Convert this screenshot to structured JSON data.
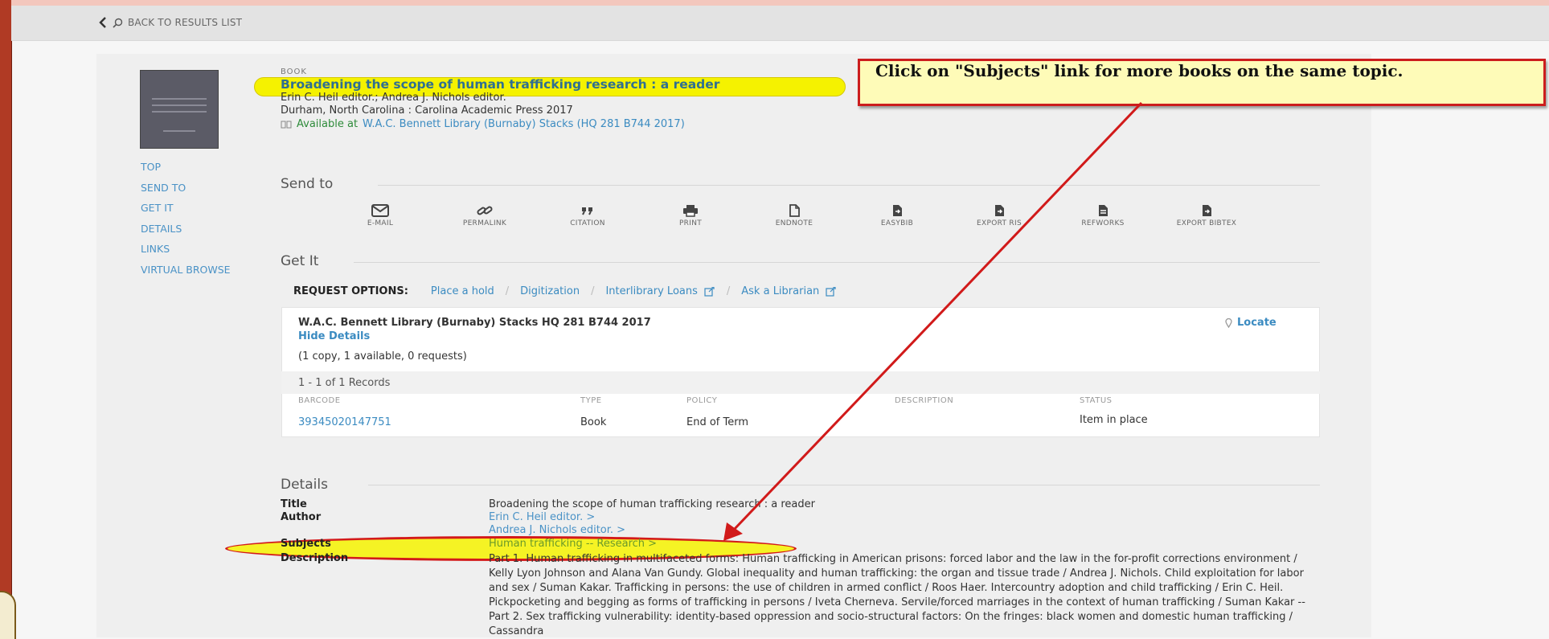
{
  "nav": {
    "back_label": "BACK TO RESULTS LIST"
  },
  "record": {
    "type": "BOOK",
    "title": "Broadening the scope of human trafficking research : a reader",
    "authors": "Erin C. Heil editor.; Andrea J. Nichols editor.",
    "publication": "Durham, North Carolina : Carolina Academic Press 2017",
    "availability_status": "Available at",
    "availability_location": "W.A.C. Bennett Library (Burnaby)  Stacks (HQ 281 B744 2017)"
  },
  "left_nav": [
    "TOP",
    "SEND TO",
    "GET IT",
    "DETAILS",
    "LINKS",
    "VIRTUAL BROWSE"
  ],
  "send_to": {
    "heading": "Send to",
    "items": [
      "E-MAIL",
      "PERMALINK",
      "CITATION",
      "PRINT",
      "ENDNOTE",
      "EASYBIB",
      "EXPORT RIS",
      "REFWORKS",
      "EXPORT BIBTEX"
    ]
  },
  "get_it": {
    "heading": "Get It",
    "request_label": "REQUEST OPTIONS:",
    "options": [
      "Place a hold",
      "Digitization",
      "Interlibrary Loans",
      "Ask a Librarian"
    ],
    "location": "W.A.C. Bennett Library (Burnaby)  Stacks  HQ 281 B744 2017",
    "hide_details": "Hide Details",
    "locate": "Locate",
    "copies": "(1 copy, 1 available, 0 requests)",
    "records": "1 - 1 of 1 Records",
    "columns": [
      "BARCODE",
      "TYPE",
      "POLICY",
      "DESCRIPTION",
      "STATUS"
    ],
    "row": {
      "barcode": "39345020147751",
      "type": "Book",
      "policy": "End of Term",
      "description": "",
      "status": "Item in place"
    }
  },
  "details": {
    "heading": "Details",
    "title_label": "Title",
    "title_value": "Broadening the scope of human trafficking research : a reader",
    "author_label": "Author",
    "authors": [
      "Erin C. Heil editor.  >",
      "Andrea J. Nichols editor.  >"
    ],
    "subjects_label": "Subjects",
    "subjects_value": "Human trafficking -- Research  >",
    "description_label": "Description",
    "description_value": "Part 1. Human trafficking in multifaceted forms: Human trafficking in American prisons: forced labor and the law in the for-profit corrections environment / Kelly Lyon Johnson and Alana Van Gundy. Global inequality and human trafficking: the organ and tissue trade / Andrea J. Nichols. Child exploitation for labor and sex / Suman Kakar. Trafficking in persons: the use of children in armed conflict / Roos Haer. Intercountry adoption and child trafficking / Erin C. Heil. Pickpocketing and begging as forms of trafficking in persons / Iveta Cherneva. Servile/forced marriages in the context of human trafficking / Suman Kakar -- Part 2. Sex trafficking vulnerability: identity-based oppression and socio-structural factors: On the fringes: black women and domestic human trafficking / Cassandra"
  },
  "annotation": {
    "callout_text": "Click on \"Subjects\" link for more books on the same topic."
  },
  "colors": {
    "link": "#3b8bc1",
    "available_green": "#2e8b3a",
    "highlight_yellow": "#f5f200",
    "annotation_red": "#cc1d1d"
  }
}
